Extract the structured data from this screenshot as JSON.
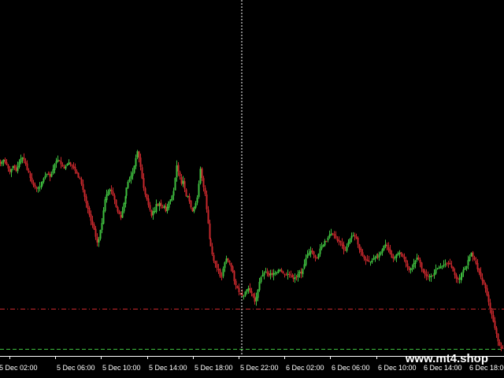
{
  "chart_data": {
    "type": "candlestick",
    "background": "#000000",
    "colors": {
      "bull": "#3fbf3f",
      "bear": "#c8282d",
      "red_level": "#c8282d",
      "green_level": "#3fbf3f",
      "separator": "#ffffff",
      "tick_label": "#ffffff",
      "axis": "#ffffff",
      "watermark": "#ffffff"
    },
    "x_ticks": [
      "5 Dec 02:00",
      "5 Dec 06:00",
      "5 Dec 10:00",
      "5 Dec 14:00",
      "5 Dec 18:00",
      "5 Dec 22:00",
      "6 Dec 02:00",
      "6 Dec 06:00",
      "6 Dec 10:00",
      "6 Dec 14:00",
      "6 Dec 18:00",
      "6 Dec"
    ],
    "separator_after_tick": "5 Dec 22:00",
    "level_lines": [
      {
        "name": "red-level",
        "value": 12.0,
        "style": "dash-dot",
        "color": "#c8282d"
      },
      {
        "name": "green-level",
        "value": 1.5,
        "style": "dashed",
        "color": "#3fbf3f"
      }
    ],
    "price_range": [
      0,
      92
    ],
    "watermark": "www.mt4.shop",
    "path": [
      50,
      50.5,
      51,
      50.2,
      49.6,
      48.7,
      47.8,
      48.6,
      49.3,
      48.8,
      48.1,
      49.2,
      50.4,
      51.3,
      51.6,
      50.7,
      49.9,
      48.3,
      47.6,
      46.2,
      45.1,
      44.3,
      43.8,
      43.5,
      43.7,
      43.9,
      44.2,
      45.3,
      46.1,
      46.8,
      47.3,
      47.1,
      46.5,
      47.3,
      48.5,
      49.9,
      50.6,
      51,
      50.6,
      49.8,
      49.2,
      48.7,
      49.4,
      49.9,
      50.3,
      49.8,
      49.4,
      48.9,
      48.1,
      47.4,
      46.3,
      45.9,
      44.6,
      43.1,
      41.3,
      39.6,
      38.2,
      36.6,
      35,
      33.9,
      32.7,
      30.8,
      29.3,
      30.2,
      32.6,
      34.4,
      37.7,
      40.6,
      41.9,
      42.7,
      43.2,
      42.7,
      41.7,
      40.5,
      38.6,
      37.4,
      36.7,
      35.8,
      37.5,
      39.6,
      41.4,
      43.7,
      45.2,
      45.9,
      46.8,
      47.6,
      49.4,
      51.4,
      53.2,
      51.5,
      49.1,
      46.1,
      43.6,
      41.9,
      40.7,
      39.1,
      37.9,
      36.3,
      37.5,
      37.5,
      39.4,
      38.9,
      39.6,
      38.8,
      38.4,
      38.9,
      37.5,
      38.6,
      40.1,
      40.6,
      41.6,
      42.8,
      46.2,
      49.5,
      47.9,
      46.6,
      44.7,
      45.5,
      43.4,
      41.4,
      41.5,
      40.1,
      38.5,
      37.5,
      38.6,
      39.6,
      41.1,
      44.7,
      48.6,
      46.2,
      43.8,
      42,
      38,
      34.3,
      30.2,
      28.3,
      26.2,
      24.5,
      23.7,
      22.6,
      22.1,
      20.4,
      20.3,
      22.5,
      24.1,
      25.1,
      24.6,
      24.1,
      23,
      21.6,
      19.2,
      18.1,
      17.3,
      16.3,
      15.8,
      15.3,
      15.3,
      16.4,
      17,
      17.3,
      16.4,
      16.1,
      15.2,
      13.8,
      14.9,
      16.9,
      19,
      20.2,
      20.8,
      21.4,
      21.7,
      21.1,
      20.6,
      21.2,
      20.9,
      21.3,
      21.3,
      21.5,
      22.1,
      22.2,
      21.6,
      21.2,
      20.9,
      20.8,
      21.1,
      20.9,
      20.7,
      20.2,
      19.8,
      20.2,
      20.2,
      21.1,
      21.6,
      21.2,
      22.4,
      23.6,
      25.2,
      26.1,
      26.6,
      27.1,
      26.9,
      26.1,
      25.4,
      25.2,
      26.3,
      27.7,
      28.3,
      28.7,
      29.7,
      29.7,
      30.5,
      31.3,
      31.6,
      31.7,
      31.1,
      30.4,
      29.8,
      29.6,
      29.3,
      28.5,
      27.4,
      27.2,
      28.3,
      29.4,
      30.3,
      31,
      31.1,
      30.9,
      30.4,
      28.8,
      27.5,
      26.8,
      25.9,
      25.1,
      24.7,
      24.4,
      24.4,
      24.3,
      24.6,
      25.1,
      25.5,
      25.7,
      25.5,
      26.2,
      26.7,
      27.5,
      28.5,
      28.8,
      28.2,
      27.3,
      26.3,
      25.3,
      25.1,
      25.4,
      26.2,
      26.5,
      26.6,
      26.1,
      25.6,
      24.9,
      24,
      23,
      22.2,
      22.4,
      22.6,
      23.9,
      24.6,
      25.3,
      24.9,
      24,
      22.5,
      21.6,
      21,
      20.5,
      20.5,
      20.4,
      20.6,
      20.6,
      21.3,
      22.3,
      22.6,
      22.6,
      23,
      23.2,
      23.4,
      23.7,
      23.8,
      23.9,
      23.5,
      22.8,
      21.7,
      20.8,
      19.9,
      19.7,
      19.8,
      20.3,
      21.4,
      22.2,
      22.6,
      23.2,
      24.7,
      25.6,
      26.6,
      25.6,
      24.8,
      23.8,
      22.3,
      21.4,
      20.3,
      19.3,
      18.5,
      17.3,
      15.5,
      13.7,
      11.8,
      10.4,
      8.6,
      6.9,
      5.4,
      3.4,
      2.2,
      1.6,
      1.5
    ]
  }
}
